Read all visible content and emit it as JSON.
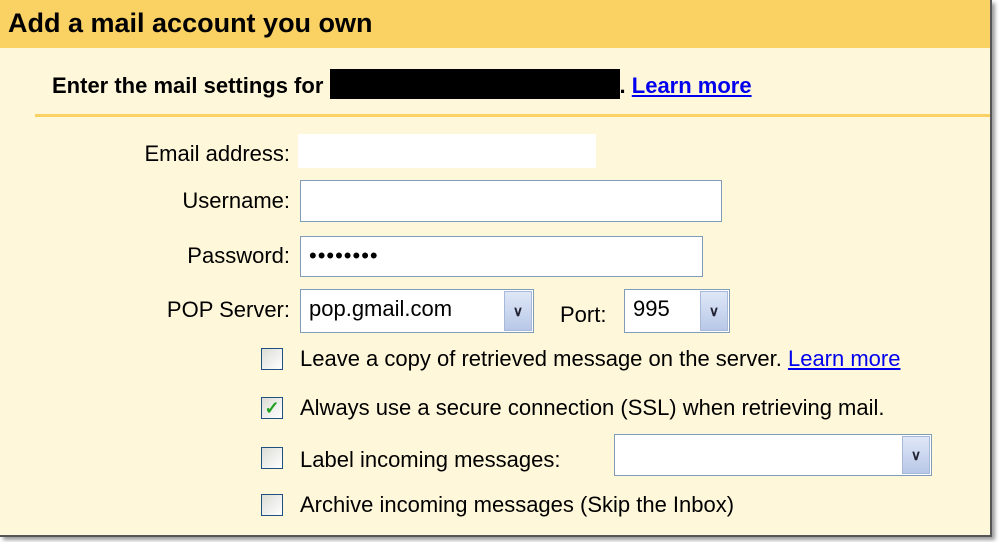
{
  "header": {
    "title": "Add a mail account you own"
  },
  "intro": {
    "text": "Enter the mail settings for",
    "suffix": ".",
    "learn_more": "Learn more"
  },
  "form": {
    "email_label": "Email address:",
    "email_value": "",
    "username_label": "Username:",
    "username_value": "",
    "password_label": "Password:",
    "password_value": "••••••••",
    "pop_label": "POP Server:",
    "pop_value": "pop.gmail.com",
    "port_label": "Port:",
    "port_value": "995"
  },
  "options": [
    {
      "label": "Leave a copy of retrieved message on the server.",
      "checked": false,
      "link": "Learn more"
    },
    {
      "label": "Always use a secure connection (SSL) when retrieving mail.",
      "checked": true,
      "link": ""
    },
    {
      "label": "Label incoming messages:",
      "checked": false,
      "link": ""
    },
    {
      "label": "Archive incoming messages (Skip the Inbox)",
      "checked": false,
      "link": ""
    }
  ],
  "label_select": {
    "value": ""
  },
  "colors": {
    "header": "#fad163",
    "panel": "#fff7d9",
    "link": "#0000ee",
    "check": "#21a121"
  }
}
